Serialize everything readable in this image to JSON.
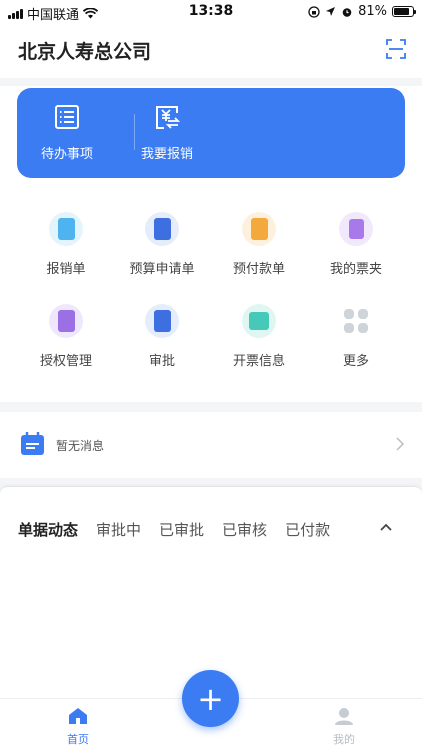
{
  "status_bar": {
    "carrier": "中国联通",
    "time": "13:38",
    "battery": "81%",
    "battery_level": 0.81
  },
  "header": {
    "title": "北京人寿总公司",
    "scan_icon": "scan-icon"
  },
  "quick_actions": [
    {
      "label": "待办事项",
      "icon": "todo-list-icon"
    },
    {
      "label": "我要报销",
      "icon": "reimburse-icon"
    }
  ],
  "functions": [
    {
      "label": "报销单",
      "icon": "expense-form-icon",
      "color": "#4fb3f0",
      "bg": "#e3f4fd"
    },
    {
      "label": "预算申请单",
      "icon": "budget-request-icon",
      "color": "#3d6fe0",
      "bg": "#e5edfc"
    },
    {
      "label": "预付款单",
      "icon": "prepayment-icon",
      "color": "#f3a93c",
      "bg": "#fdf1de"
    },
    {
      "label": "我的票夹",
      "icon": "ticket-wallet-icon",
      "color": "#a779ea",
      "bg": "#f1e8fc"
    },
    {
      "label": "授权管理",
      "icon": "authorization-icon",
      "color": "#9a70e4",
      "bg": "#efe8fc"
    },
    {
      "label": "审批",
      "icon": "approval-icon",
      "color": "#3d6fe0",
      "bg": "#e5edfc"
    },
    {
      "label": "开票信息",
      "icon": "invoice-info-icon",
      "color": "#47c9b9",
      "bg": "#e0f6f3"
    },
    {
      "label": "更多",
      "icon": "more-icon",
      "color": "#cfd3da",
      "bg": "#ffffff"
    }
  ],
  "message": {
    "text": "暂无消息",
    "icon": "calendar-icon"
  },
  "doc_tabs": [
    {
      "label": "单据动态",
      "active": true
    },
    {
      "label": "审批中",
      "active": false
    },
    {
      "label": "已审批",
      "active": false
    },
    {
      "label": "已审核",
      "active": false
    },
    {
      "label": "已付款",
      "active": false
    }
  ],
  "tabbar": [
    {
      "label": "首页",
      "icon": "home-icon",
      "active": true
    },
    {
      "label": "我的",
      "icon": "profile-icon",
      "active": false
    }
  ],
  "fab": {
    "label": "+"
  },
  "colors": {
    "primary": "#3b7cf2",
    "background": "#f4f5f7",
    "inactive": "#b7bcc5"
  }
}
